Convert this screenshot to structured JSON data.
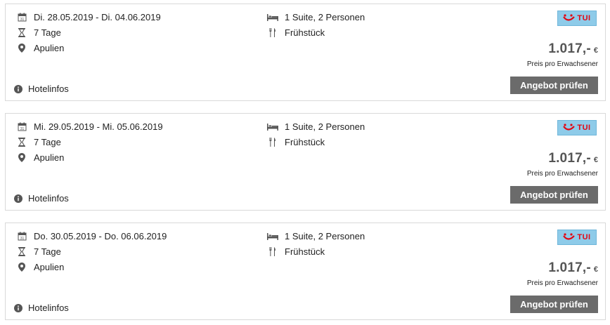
{
  "offers": [
    {
      "date_range": "Di. 28.05.2019 - Di. 04.06.2019",
      "duration": "7 Tage",
      "location": "Apulien",
      "room": "1 Suite, 2 Personen",
      "board": "Frühstück",
      "hotelinfos_label": "Hotelinfos",
      "provider_logo": "TUI",
      "price": "1.017,-",
      "currency": "€",
      "price_note": "Preis pro Erwachsener",
      "button_label": "Angebot prüfen"
    },
    {
      "date_range": "Mi. 29.05.2019 - Mi. 05.06.2019",
      "duration": "7 Tage",
      "location": "Apulien",
      "room": "1 Suite, 2 Personen",
      "board": "Frühstück",
      "hotelinfos_label": "Hotelinfos",
      "provider_logo": "TUI",
      "price": "1.017,-",
      "currency": "€",
      "price_note": "Preis pro Erwachsener",
      "button_label": "Angebot prüfen"
    },
    {
      "date_range": "Do. 30.05.2019 - Do. 06.06.2019",
      "duration": "7 Tage",
      "location": "Apulien",
      "room": "1 Suite, 2 Personen",
      "board": "Frühstück",
      "hotelinfos_label": "Hotelinfos",
      "provider_logo": "TUI",
      "price": "1.017,-",
      "currency": "€",
      "price_note": "Preis pro Erwachsener",
      "button_label": "Angebot prüfen"
    }
  ],
  "icons": {
    "date": "calendar-icon",
    "duration": "hourglass-icon",
    "location": "map-pin-icon",
    "room": "bed-icon",
    "board": "cutlery-icon",
    "info": "info-icon"
  },
  "colors": {
    "button_bg": "#6b6b6b",
    "logo_bg": "#8ecbe9",
    "logo_red": "#e30613",
    "price_text": "#555555",
    "border": "#d9d9d9"
  }
}
